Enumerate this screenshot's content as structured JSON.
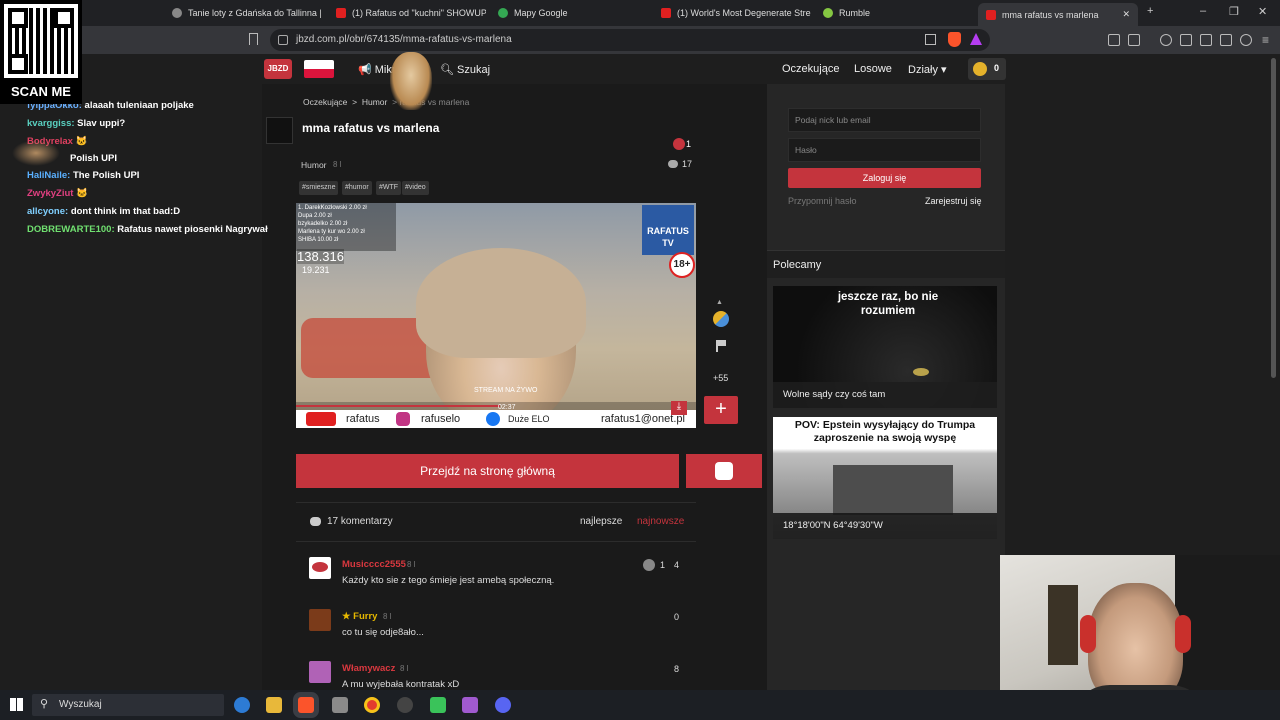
{
  "browser": {
    "tabs": [
      {
        "label": "Tanie loty z Gdańska do Tallinna | Wi",
        "color": "#888"
      },
      {
        "label": "(1) Rafatus od \"kuchni\" SHOWUP [H",
        "color": "#e02020"
      },
      {
        "label": "Mapy Google",
        "color": "#34a853"
      },
      {
        "label": "(1) World's Most Degenerate Stream",
        "color": "#e02020"
      },
      {
        "label": "Rumble",
        "color": "#85c742"
      },
      {
        "label": "mma rafatus vs marlena",
        "color": "#e02020"
      }
    ],
    "url": "jbzd.com.pl/obr/674135/mma-rafatus-vs-marlena"
  },
  "overlay": {
    "scan_label": "SCAN ME"
  },
  "site": {
    "logo": "JBZD",
    "nav": {
      "mikro": "Mikro",
      "search": "Szukaj",
      "oczekujace": "Oczekujące",
      "losowe": "Losowe",
      "dzialy": "Działy",
      "coins": "0"
    },
    "breadcrumb": {
      "root": "Oczekujące",
      "sep": ">",
      "cat": "Humor",
      "sep2": ">",
      "title": "rafatus vs marlena"
    },
    "post": {
      "title": "mma rafatus vs marlena",
      "badge_count": "1",
      "category": "Humor",
      "age": "8 l",
      "comments_count": "17",
      "tags": [
        "#smieszne",
        "#humor",
        "#WTF",
        "#video"
      ],
      "votes": "+55"
    },
    "video": {
      "donations": [
        "1. DarekKozłowski 2.00 zł",
        "Dupa 2.00 zł",
        "bzykadelko 2.00 zł",
        "Marlena ty kur wo 2.00 zł",
        "SHIBA 10.00 zł"
      ],
      "viewers": "138.316",
      "sub": "19.231",
      "brand": "RAFATUS",
      "brand2": "TV",
      "age_badge": "18+",
      "stream_text": "STREAM NA ŻYWO",
      "time": "02:37",
      "footer_yt": "rafatus",
      "footer_ig": "rafuselo",
      "footer_fb": "Duże ELO",
      "footer_mail": "rafatus1@onet.pl"
    },
    "buttons": {
      "home": "Przejdź na stronę główną",
      "plus": "+"
    },
    "comments": {
      "header": "17 komentarzy",
      "sort_best": "najlepsze",
      "sort_new": "najnowsze",
      "items": [
        {
          "nick": "Musicccc2555",
          "age": "8 l",
          "text": "Każdy kto sie z tego śmieje jest amebą społeczną.",
          "badge": "1",
          "score": "4",
          "nick_color": "#d9383f"
        },
        {
          "nick": "★ Furry",
          "age": "8 l",
          "text": "co tu się odje8ało...",
          "badge": "",
          "score": "0",
          "nick_color": "#e6b800"
        },
        {
          "nick": "Włamywacz",
          "age": "8 l",
          "text": "A mu wyjebała kontratak xD",
          "badge": "",
          "score": "8",
          "nick_color": "#d9383f"
        }
      ]
    },
    "sidebar": {
      "login_placeholder": "Podaj nick lub email",
      "pass_placeholder": "Hasło",
      "login_btn": "Zaloguj się",
      "remind": "Przypomnij hasło",
      "register": "Zarejestruj się",
      "recommended": "Polecamy",
      "cards": [
        {
          "caption": "Wolne sądy czy coś tam",
          "overlay": "jeszcze raz, bo nie rozumiem"
        },
        {
          "caption": "18°18'00\"N 64°49'30\"W",
          "overlay": "POV: Epstein wysyłający do Trumpa zaproszenie na swoją wyspę"
        }
      ]
    }
  },
  "chat": [
    {
      "user": "fyippaOkko:",
      "msg": "alaaah tuleniaan poljake",
      "color": "#6ab0ff"
    },
    {
      "user": "kvarggiss:",
      "msg": "Slav uppi?",
      "color": "#5ad0c0"
    },
    {
      "user": "Bodyrelax",
      "msg": "",
      "color": "#e04060"
    },
    {
      "user": "",
      "msg": "Polish UPI",
      "color": "#e04060"
    },
    {
      "user": "HaliNaile:",
      "msg": "The Polish UPI",
      "color": "#5ab0ff"
    },
    {
      "user": "ZwykyZiut",
      "msg": "",
      "color": "#e04080"
    },
    {
      "user": "allcyone:",
      "msg": "dont think im that bad:D",
      "color": "#80d0ff"
    },
    {
      "user": "DOBREWARTE100:",
      "msg": "Rafatus nawet piosenki Nagrywał",
      "color": "#70e070"
    }
  ],
  "taskbar": {
    "search": "Wyszukaj"
  }
}
